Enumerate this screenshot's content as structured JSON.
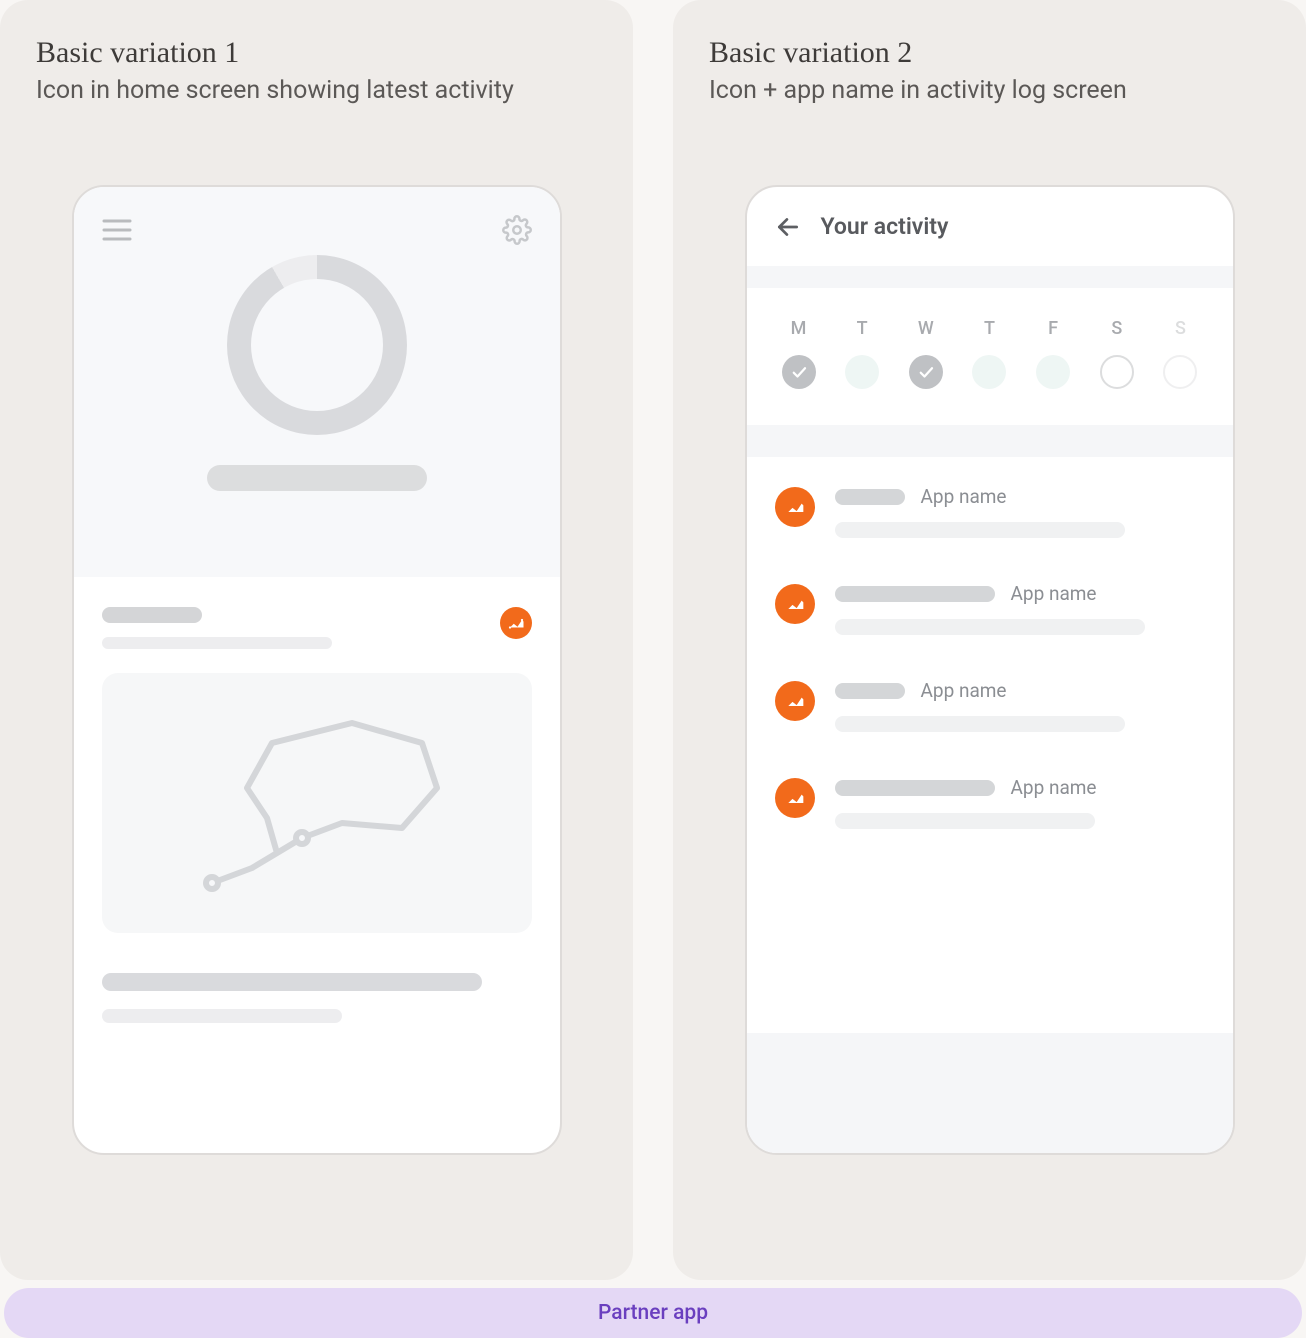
{
  "left": {
    "title": "Basic variation 1",
    "subtitle": "Icon in home screen showing latest activity"
  },
  "right": {
    "title": "Basic variation 2",
    "subtitle": "Icon + app name in activity log screen",
    "screenTitle": "Your activity",
    "days": [
      "M",
      "T",
      "W",
      "T",
      "F",
      "S",
      "S"
    ],
    "itemLabel": "App name"
  },
  "footer": "Partner app",
  "colors": {
    "accent": "#f26a1b",
    "legendBg": "#e4d8f5",
    "legendText": "#6a3fbf"
  }
}
